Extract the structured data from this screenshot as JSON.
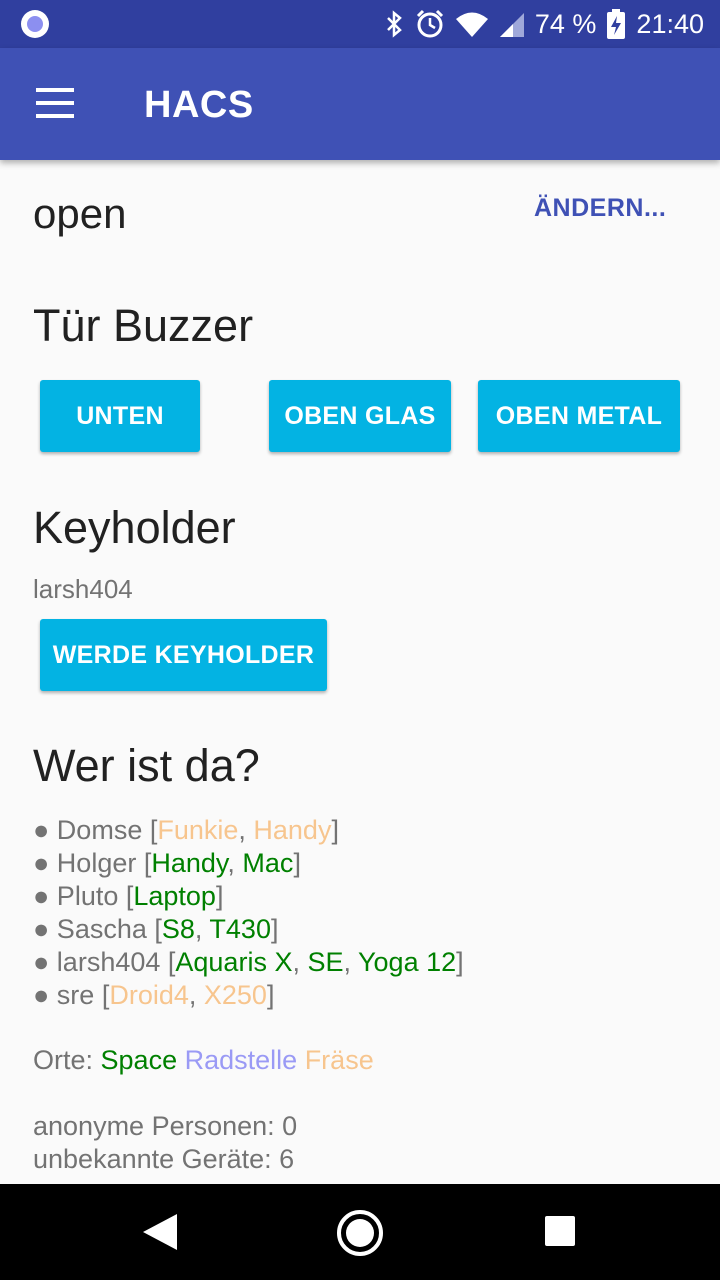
{
  "status_bar": {
    "battery": "74 %",
    "time": "21:40",
    "icons": [
      "notification-dot-icon",
      "bluetooth-icon",
      "alarm-icon",
      "wifi-icon",
      "signal-icon",
      "battery-charging-icon"
    ]
  },
  "app_bar": {
    "title": "HACS"
  },
  "door_state": {
    "value": "open",
    "change_label": "ÄNDERN..."
  },
  "buzzer": {
    "heading": "Tür Buzzer",
    "buttons": [
      "UNTEN",
      "OBEN GLAS",
      "OBEN METAL"
    ]
  },
  "keyholder": {
    "heading": "Keyholder",
    "name": "larsh404",
    "button": "WERDE KEYHOLDER"
  },
  "presence": {
    "heading": "Wer ist da?",
    "bullet": "●",
    "people": [
      {
        "name": "Domse",
        "devices": [
          {
            "name": "Funkie",
            "status": "away"
          },
          {
            "name": "Handy",
            "status": "away"
          }
        ]
      },
      {
        "name": "Holger",
        "devices": [
          {
            "name": "Handy",
            "status": "present"
          },
          {
            "name": "Mac",
            "status": "present"
          }
        ]
      },
      {
        "name": "Pluto",
        "devices": [
          {
            "name": "Laptop",
            "status": "present"
          }
        ]
      },
      {
        "name": "Sascha",
        "devices": [
          {
            "name": "S8",
            "status": "present"
          },
          {
            "name": "T430",
            "status": "present"
          }
        ]
      },
      {
        "name": "larsh404",
        "devices": [
          {
            "name": "Aquaris X",
            "status": "present"
          },
          {
            "name": "SE",
            "status": "present"
          },
          {
            "name": "Yoga 12",
            "status": "present"
          }
        ]
      },
      {
        "name": "sre",
        "devices": [
          {
            "name": "Droid4",
            "status": "away"
          },
          {
            "name": "X250",
            "status": "away"
          }
        ]
      }
    ],
    "places_label": "Orte:",
    "places": [
      {
        "name": "Space",
        "color": "#008000"
      },
      {
        "name": "Radstelle",
        "color": "#9a9af5"
      },
      {
        "name": "Fräse",
        "color": "#f7c58e"
      }
    ],
    "anonymous_label": "anonyme Personen: 0",
    "unknown_label": "unbekannte Geräte: 6"
  },
  "colors": {
    "primary": "#3f51b5",
    "primary_dark": "#303f9f",
    "button": "#03b3e3",
    "present": "#008000",
    "away": "#f7c58e"
  }
}
